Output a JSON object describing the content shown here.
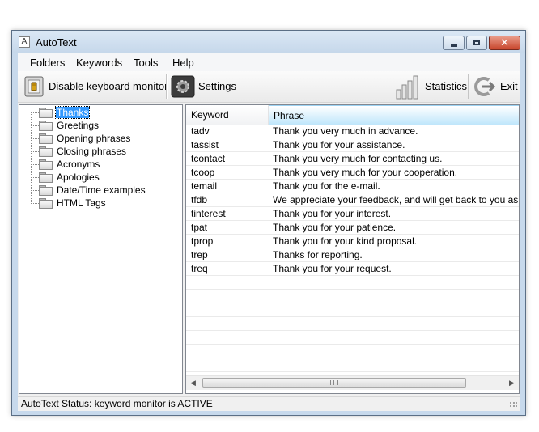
{
  "window": {
    "title": "AutoText",
    "icon_letter": "A"
  },
  "titlebar_buttons": {
    "close_glyph": "✕"
  },
  "menu": {
    "items": [
      "Folders",
      "Keywords",
      "Tools",
      "Help"
    ]
  },
  "toolbar": {
    "disable_monitor_label": "Disable keyboard monitor",
    "settings_label": "Settings",
    "statistics_label": "Statistics",
    "exit_label": "Exit"
  },
  "tree": {
    "items": [
      {
        "label": "Thanks",
        "selected": true
      },
      {
        "label": "Greetings"
      },
      {
        "label": "Opening phrases"
      },
      {
        "label": "Closing phrases"
      },
      {
        "label": "Acronyms"
      },
      {
        "label": "Apologies"
      },
      {
        "label": "Date/Time examples"
      },
      {
        "label": "HTML Tags"
      }
    ]
  },
  "list": {
    "columns": [
      "Keyword",
      "Phrase"
    ],
    "rows": [
      {
        "keyword": "tadv",
        "phrase": "Thank you very much in advance."
      },
      {
        "keyword": "tassist",
        "phrase": "Thank you for your assistance."
      },
      {
        "keyword": "tcontact",
        "phrase": "Thank you very much for contacting us."
      },
      {
        "keyword": "tcoop",
        "phrase": "Thank you very much for your cooperation."
      },
      {
        "keyword": "temail",
        "phrase": "Thank you for the e-mail."
      },
      {
        "keyword": "tfdb",
        "phrase": "We appreciate your feedback, and will get back to you as soon a"
      },
      {
        "keyword": "tinterest",
        "phrase": "Thank you for your interest."
      },
      {
        "keyword": "tpat",
        "phrase": "Thank you for your patience."
      },
      {
        "keyword": "tprop",
        "phrase": "Thank you for your kind proposal."
      },
      {
        "keyword": "trep",
        "phrase": "Thanks for reporting."
      },
      {
        "keyword": "treq",
        "phrase": "Thank you for your request."
      }
    ]
  },
  "scrollbar": {
    "left_arrow": "◀",
    "right_arrow": "▶"
  },
  "status": {
    "text": "AutoText Status: keyword monitor is ACTIVE"
  },
  "colors": {
    "selection": "#3399ff",
    "window_frame": "#c7d9ec",
    "close_button": "#c8452b"
  }
}
